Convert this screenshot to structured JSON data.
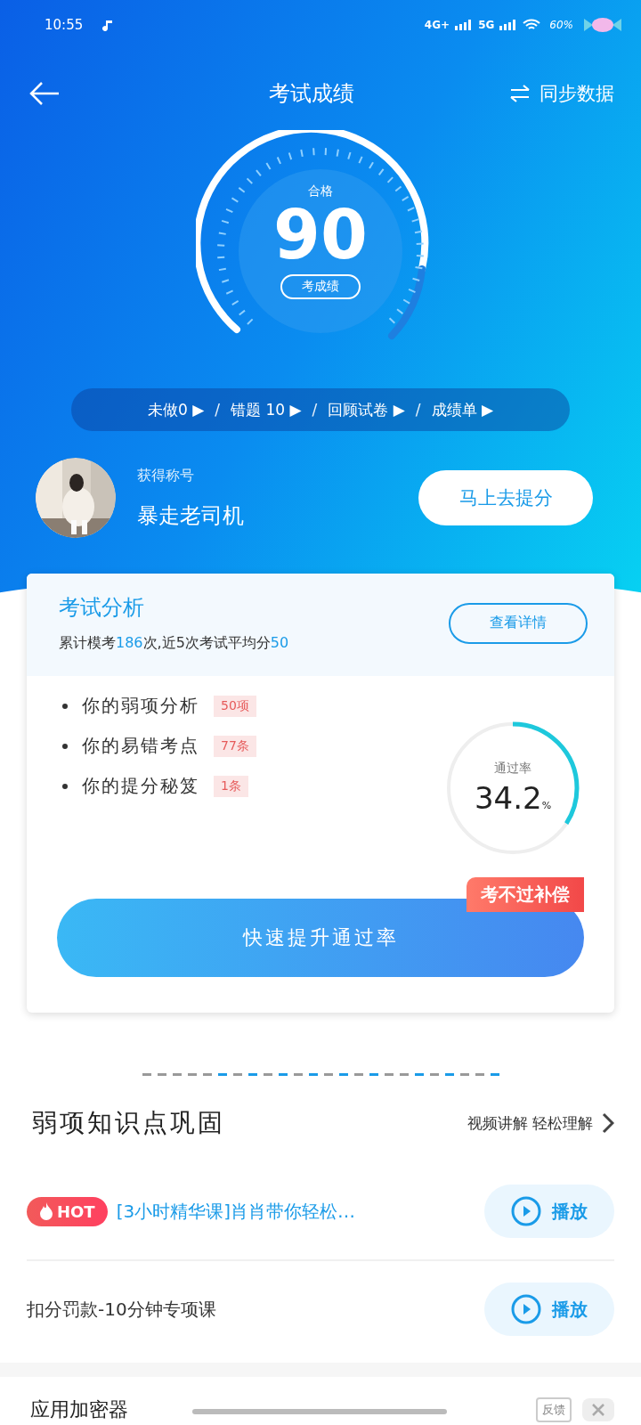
{
  "status_bar": {
    "time": "10:55",
    "network_1": "4G+",
    "network_2": "5G",
    "battery": "60%"
  },
  "header": {
    "title": "考试成绩",
    "action": "同步数据"
  },
  "score": {
    "label": "合格",
    "value": "90",
    "button": "考成绩"
  },
  "shortcuts": [
    {
      "label": "未做0 ▶"
    },
    {
      "separator": "/",
      "label": "错题 10 ▶"
    },
    {
      "separator": "/",
      "label": "回顾试卷 ▶"
    },
    {
      "separator": "/",
      "label": "成绩单 ▶"
    }
  ],
  "profile": {
    "caption": "获得称号",
    "title": "暴走老司机",
    "button": "马上去提分"
  },
  "analysis": {
    "title": "考试分析",
    "summary": [
      {
        "text": "累计模考",
        "highlight": false
      },
      {
        "text": "186",
        "highlight": true
      },
      {
        "text": "次,近5次考试平均分",
        "highlight": false
      },
      {
        "text": "50",
        "highlight": true
      }
    ],
    "detail_button": "查看详情",
    "items": [
      {
        "label": "你的弱项分析",
        "tag": "50项"
      },
      {
        "label": "你的易错考点",
        "tag": "77条"
      },
      {
        "label": "你的提分秘笈",
        "tag": "1条"
      }
    ],
    "pass_rate": {
      "label": "通过率",
      "value": "34.2",
      "unit": "%",
      "level": 0.342
    },
    "main_button": "快速提升通过率",
    "ribbon": "考不过补偿"
  },
  "weak_points": {
    "title": "弱项知识点巩固",
    "link": "视频讲解 轻松理解",
    "courses": [
      {
        "title": "[3小时精华课]肖肖带你轻松…",
        "hot": true,
        "badge": "HOT",
        "button": "播放"
      },
      {
        "title": "扣分罚款-10分钟专项课",
        "hot": false,
        "button": "播放"
      }
    ]
  },
  "ad": {
    "title": "应用加密器",
    "feedback": "反馈"
  }
}
